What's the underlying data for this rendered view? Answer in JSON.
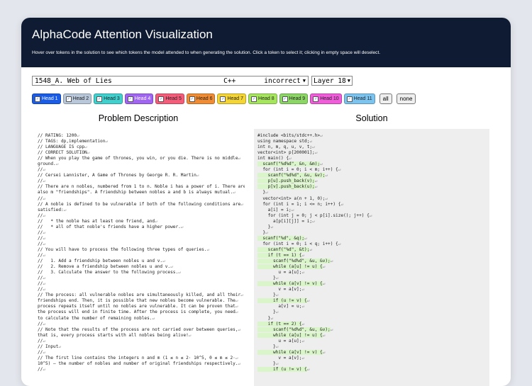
{
  "header": {
    "title": "AlphaCode Attention Visualization",
    "subtitle": "Hover over tokens in the solution to see which tokens the model attended to when generating the solution. Click a token to select it; clicking in empty space will deselect."
  },
  "controls": {
    "problem": "1548_A. Web of Lies",
    "language": "C++",
    "verdict": "incorrect",
    "layer": "Layer 18"
  },
  "heads": [
    {
      "label": "Head 1",
      "color": "#1a5ce6",
      "text_color": "#ffffff"
    },
    {
      "label": "Head 2",
      "color": "#b8c7d9",
      "text_color": "#222222"
    },
    {
      "label": "Head 3",
      "color": "#40d1cf",
      "text_color": "#222222"
    },
    {
      "label": "Head 4",
      "color": "#a066f2",
      "text_color": "#ffffff"
    },
    {
      "label": "Head 5",
      "color": "#f55c7a",
      "text_color": "#222222"
    },
    {
      "label": "Head 6",
      "color": "#f28c33",
      "text_color": "#222222"
    },
    {
      "label": "Head 7",
      "color": "#f5d533",
      "text_color": "#222222"
    },
    {
      "label": "Head 8",
      "color": "#a6e65c",
      "text_color": "#222222"
    },
    {
      "label": "Head 9",
      "color": "#8cd666",
      "text_color": "#222222"
    },
    {
      "label": "Head 10",
      "color": "#f05cd9",
      "text_color": "#222222"
    },
    {
      "label": "Head 11",
      "color": "#7cc4f0",
      "text_color": "#222222"
    }
  ],
  "buttons": {
    "all": "all",
    "none": "none"
  },
  "columns": {
    "problem_title": "Problem Description",
    "solution_title": "Solution"
  },
  "return_symbol": "↵",
  "problem_lines": [
    "// RATING: 1200",
    "// TAGS: dp,implementation",
    "// LANGUAGE IS cpp",
    "// CORRECT SOLUTION",
    "// When you play the game of thrones, you win, or you die. There is no middle",
    "ground.",
    "//",
    "// Cersei Lannister, A Game of Thrones by George R. R. Martin",
    "//",
    "// There are n nobles, numbered from 1 to n. Noble i has a power of i. There are",
    "also m \"friendships\". A friendship between nobles a and b is always mutual.",
    "//",
    "// A noble is defined to be vulnerable if both of the following conditions are",
    "satisfied:",
    "//",
    "//   * the noble has at least one friend, and",
    "//   * all of that noble's friends have a higher power.",
    "//",
    "//",
    "//",
    "// You will have to process the following three types of queries.",
    "//",
    "//   1. Add a friendship between nobles u and v.",
    "//   2. Remove a friendship between nobles u and v.",
    "//   3. Calculate the answer to the following process.",
    "//",
    "//",
    "//",
    "// The process: all vulnerable nobles are simultaneously killed, and all their",
    "friendships end. Then, it is possible that new nobles become vulnerable. The",
    "process repeats itself until no nobles are vulnerable. It can be proven that",
    "the process will end in finite time. After the process is complete, you need",
    "to calculate the number of remaining nobles.",
    "//",
    "// Note that the results of the process are not carried over between queries,",
    "that is, every process starts with all nobles being alive!",
    "//",
    "// Input",
    "//",
    "// The first line contains the integers n and m (1 ≤ n ≤ 2· 10^5, 0 ≤ m ≤ 2·",
    "10^5) — the number of nobles and number of original friendships respectively.",
    "//"
  ],
  "solution_lines": [
    "#include <bits/stdc++.h>",
    "using namespace std;",
    "int n, m, q, u, v, t;",
    "vector<int> p[200001];",
    "int main() {",
    "  scanf(\"%d%d\", &n, &m);",
    "  for (int i = 0; i < m; i++) {",
    "    scanf(\"%d%d\", &u, &v);",
    "    p[u].push_back(v);",
    "    p[v].push_back(u);",
    "  }",
    "  vector<int> a(n + 1, 0);",
    "  for (int i = 1; i <= n; i++) {",
    "    a[i] = i;",
    "    for (int j = 0; j < p[i].size(); j++) {",
    "      a[p[i][j]] = i;",
    "    }",
    "  }",
    "  scanf(\"%d\", &q);",
    "  for (int i = 0; i < q; i++) {",
    "    scanf(\"%d\", &t);",
    "    if (t == 1) {",
    "      scanf(\"%d%d\", &u, &v);",
    "      while (a[u] != u) {",
    "        u = a[u];",
    "      }",
    "      while (a[v] != v) {",
    "        v = a[v];",
    "      }",
    "      if (u != v) {",
    "        a[v] = u;",
    "      }",
    "    }",
    "    if (t == 2) {",
    "      scanf(\"%d%d\", &u, &v);",
    "      while (a[u] != u) {",
    "        u = a[u];",
    "      }",
    "      while (a[v] != v) {",
    "        v = a[v];",
    "      }",
    "      if (u != v) {"
  ]
}
